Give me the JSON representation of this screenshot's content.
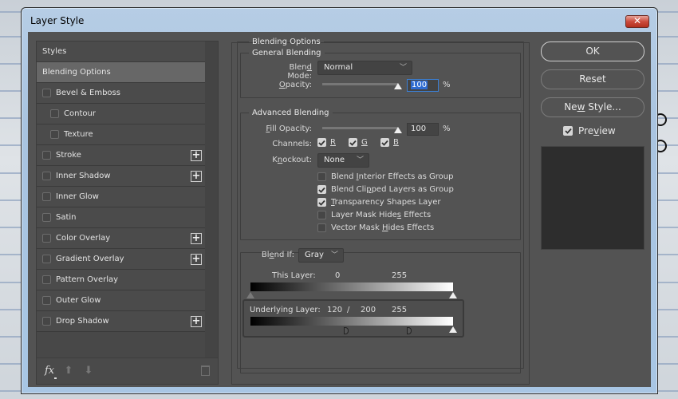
{
  "window": {
    "title": "Layer Style",
    "close_icon": "close-icon"
  },
  "styles_panel": {
    "items": [
      {
        "label": "Styles",
        "checkbox": false,
        "checked": false,
        "indent": false,
        "selected": false,
        "plus": false
      },
      {
        "label": "Blending Options",
        "checkbox": false,
        "checked": false,
        "indent": false,
        "selected": true,
        "plus": false
      },
      {
        "label": "Bevel & Emboss",
        "checkbox": true,
        "checked": false,
        "indent": false,
        "selected": false,
        "plus": false
      },
      {
        "label": "Contour",
        "checkbox": true,
        "checked": false,
        "indent": true,
        "selected": false,
        "plus": false
      },
      {
        "label": "Texture",
        "checkbox": true,
        "checked": false,
        "indent": true,
        "selected": false,
        "plus": false
      },
      {
        "label": "Stroke",
        "checkbox": true,
        "checked": false,
        "indent": false,
        "selected": false,
        "plus": true
      },
      {
        "label": "Inner Shadow",
        "checkbox": true,
        "checked": false,
        "indent": false,
        "selected": false,
        "plus": true
      },
      {
        "label": "Inner Glow",
        "checkbox": true,
        "checked": false,
        "indent": false,
        "selected": false,
        "plus": false
      },
      {
        "label": "Satin",
        "checkbox": true,
        "checked": false,
        "indent": false,
        "selected": false,
        "plus": false
      },
      {
        "label": "Color Overlay",
        "checkbox": true,
        "checked": false,
        "indent": false,
        "selected": false,
        "plus": true
      },
      {
        "label": "Gradient Overlay",
        "checkbox": true,
        "checked": false,
        "indent": false,
        "selected": false,
        "plus": true
      },
      {
        "label": "Pattern Overlay",
        "checkbox": true,
        "checked": false,
        "indent": false,
        "selected": false,
        "plus": false
      },
      {
        "label": "Outer Glow",
        "checkbox": true,
        "checked": false,
        "indent": false,
        "selected": false,
        "plus": false
      },
      {
        "label": "Drop Shadow",
        "checkbox": true,
        "checked": false,
        "indent": false,
        "selected": false,
        "plus": true
      }
    ],
    "plus_label": "+",
    "footer": {
      "fx_label": "fx",
      "up_label": "⬆",
      "down_label": "⬇"
    }
  },
  "blending_options": {
    "title": "Blending Options",
    "general": {
      "title": "General Blending",
      "blend_mode_label_pre": "Blen",
      "blend_mode_label_u": "d",
      "blend_mode_label_post": " Mode:",
      "blend_mode_value": "Normal",
      "opacity_label_u": "O",
      "opacity_label_post": "pacity:",
      "opacity_value": "100",
      "opacity_percent": 100,
      "percent_sign": "%"
    },
    "advanced": {
      "title": "Advanced Blending",
      "fill_label_u": "F",
      "fill_label_post": "ill Opacity:",
      "fill_value": "100",
      "fill_percent": 100,
      "percent_sign": "%",
      "channels_label": "Channels:",
      "channels": [
        {
          "label": "R",
          "checked": true
        },
        {
          "label": "G",
          "checked": true
        },
        {
          "label": "B",
          "checked": true
        }
      ],
      "knockout_label_pre": "K",
      "knockout_label_u": "n",
      "knockout_label_post": "ockout:",
      "knockout_value": "None",
      "options": [
        {
          "pre": "Blend ",
          "u": "I",
          "post": "nterior Effects as Group",
          "checked": false
        },
        {
          "pre": "Blend Cli",
          "u": "p",
          "post": "ped Layers as Group",
          "checked": true
        },
        {
          "pre": "",
          "u": "T",
          "post": "ransparency Shapes Layer",
          "checked": true
        },
        {
          "pre": "Layer Mask Hide",
          "u": "s",
          "post": " Effects",
          "checked": false
        },
        {
          "pre": "Vector Mask ",
          "u": "H",
          "post": "ides Effects",
          "checked": false
        }
      ]
    },
    "blend_if": {
      "label_pre": "Bl",
      "label_u": "e",
      "label_post": "nd If:",
      "channel_value": "Gray",
      "this_layer": {
        "label": "This Layer:",
        "black": "0",
        "white": "255",
        "black_value": 0,
        "white_value": 255
      },
      "underlying_layer": {
        "label": "Underlying Layer:",
        "black_low": "120",
        "separator": "/",
        "black_high": "200",
        "white": "255",
        "black_low_value": 120,
        "black_high_value": 200,
        "white_value": 255
      }
    }
  },
  "buttons": {
    "ok": "OK",
    "reset": "Reset",
    "new_style_pre": "Ne",
    "new_style_u": "w",
    "new_style_post": " Style...",
    "preview_pre": "Pre",
    "preview_u": "v",
    "preview_post": "iew",
    "preview_checked": true
  }
}
